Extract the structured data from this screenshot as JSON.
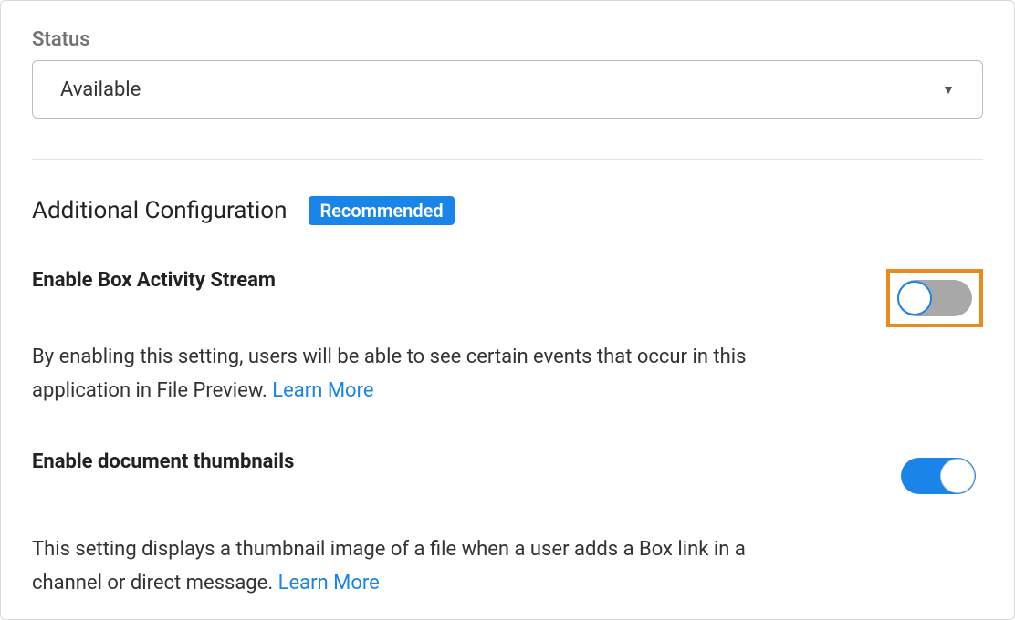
{
  "status": {
    "label": "Status",
    "selected": "Available"
  },
  "section": {
    "title": "Additional Configuration",
    "badge": "Recommended"
  },
  "settings": [
    {
      "title": "Enable Box Activity Stream",
      "desc": "By enabling this setting, users will be able to see certain events that occur in this application in File Preview. ",
      "learn_more": "Learn More",
      "on": false,
      "highlight": true
    },
    {
      "title": "Enable document thumbnails",
      "desc": "This setting displays a thumbnail image of a file when a user adds a Box link in a channel or direct message. ",
      "learn_more": "Learn More",
      "on": true,
      "highlight": false
    }
  ]
}
